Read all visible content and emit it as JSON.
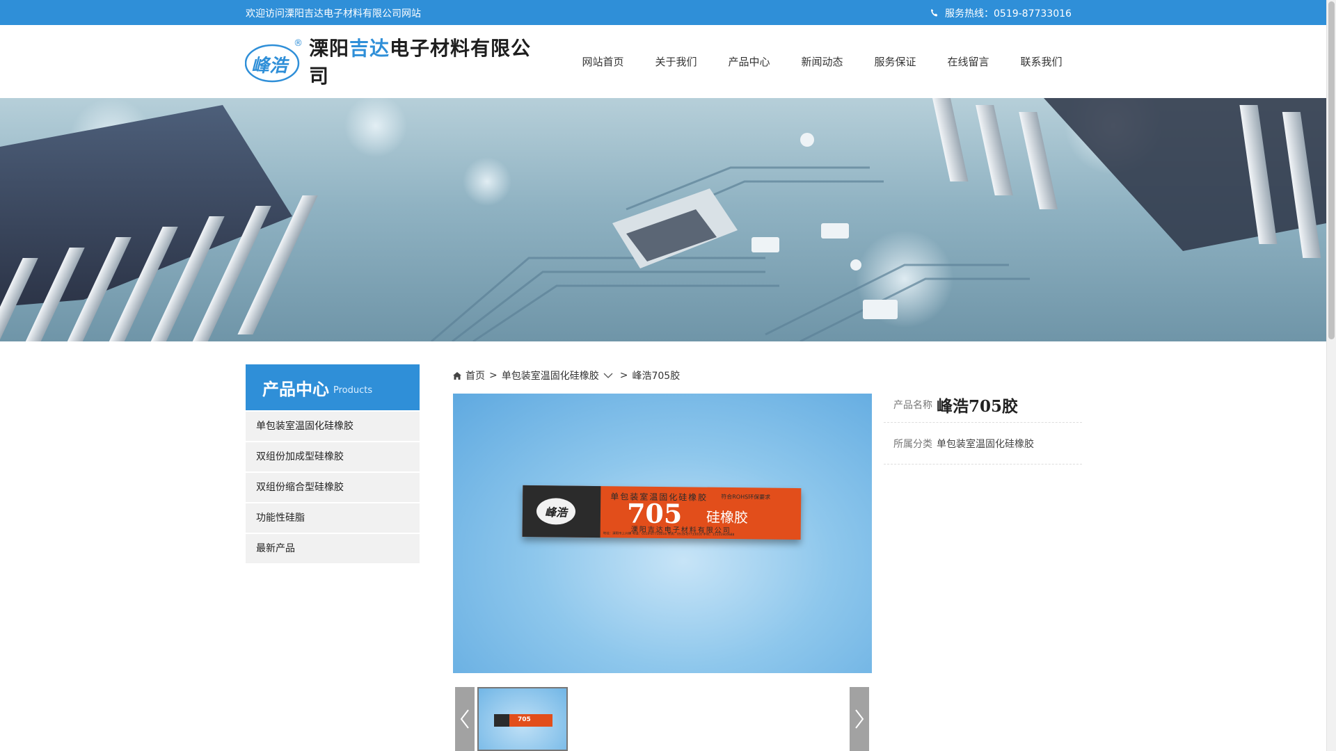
{
  "topbar": {
    "welcome": "欢迎访问溧阳吉达电子材料有限公司网站",
    "hotline": "服务热线：0519-87733016"
  },
  "logo": {
    "mark": "峰浩",
    "registered": "®",
    "name_part1": "溧阳",
    "name_part2": "吉达",
    "name_part3": "电子材料有限公司"
  },
  "nav": {
    "items": [
      {
        "label": "网站首页"
      },
      {
        "label": "关于我们"
      },
      {
        "label": "产品中心"
      },
      {
        "label": "新闻动态"
      },
      {
        "label": "服务保证"
      },
      {
        "label": "在线留言"
      },
      {
        "label": "联系我们"
      }
    ]
  },
  "sidebar": {
    "title": "产品中心",
    "title_en": "Products",
    "items": [
      {
        "label": "单包装室温固化硅橡胶"
      },
      {
        "label": "双组份加成型硅橡胶"
      },
      {
        "label": "双组份缩合型硅橡胶"
      },
      {
        "label": "功能性硅脂"
      },
      {
        "label": "最新产品"
      }
    ]
  },
  "breadcrumb": {
    "home": "首页",
    "sep": ">",
    "category": "单包装室温固化硅橡胶",
    "current": "峰浩705胶"
  },
  "product": {
    "box_top": "单包装室温固化硅橡胶",
    "box_rohs": "符合ROHS环保要求",
    "box_number": "705",
    "box_name": "硅橡胶",
    "box_company": "溧阳吉达电子材料有限公司",
    "box_logo": "峰浩",
    "box_small": "地址：溧阳市上兴镇 电话：0519-87733016 传真：0519-87733016 手机：15151905688",
    "thumb_number": "705"
  },
  "info": {
    "name_label": "产品名称",
    "name_value": "峰浩705胶",
    "cat_label": "所属分类",
    "cat_value": "单包装室温固化硅橡胶"
  },
  "colors": {
    "accent": "#2f8fd8",
    "box_orange": "#e24e1b"
  },
  "icons": {
    "phone": "phone-icon",
    "home": "home-icon",
    "chevron": "chevron-down-icon",
    "prev": "chevron-left-icon",
    "next": "chevron-right-icon"
  }
}
